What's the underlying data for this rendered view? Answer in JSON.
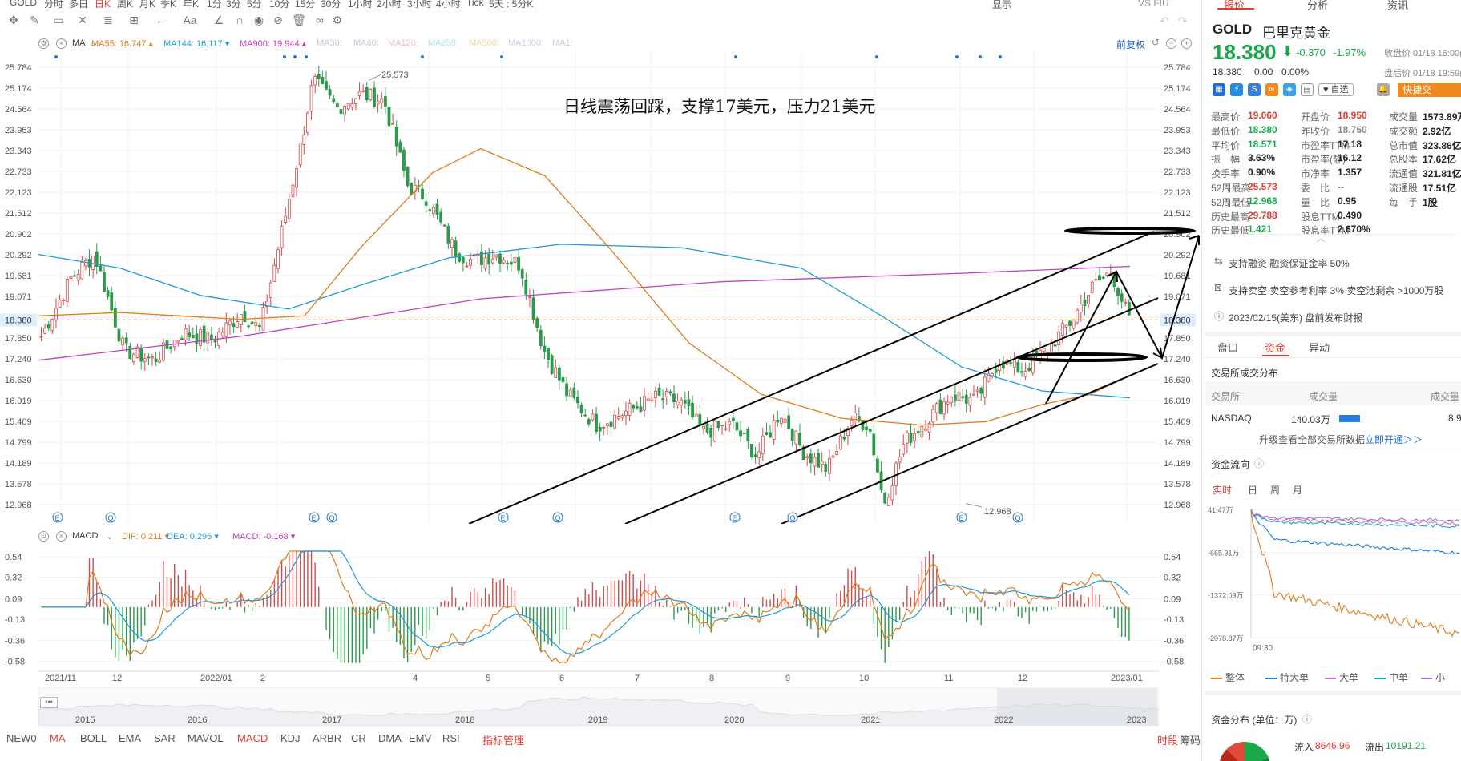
{
  "periods": [
    "GOLD",
    "分时",
    "多日",
    "日K",
    "周K",
    "月K",
    "季K",
    "年K",
    "1分",
    "3分",
    "5分",
    "10分",
    "15分",
    "30分",
    "1小时",
    "2小时",
    "3小时",
    "4小时",
    "Tick",
    "5天 : 5分K"
  ],
  "periods_active": 3,
  "toolbar_right": {
    "display": "显示",
    "vs": "VS FIU"
  },
  "ma_bar": {
    "label": "MA",
    "items": [
      {
        "text": "MA55: 16.747 ▴",
        "color": "#e07b1a"
      },
      {
        "text": "MA144: 16.117 ▾",
        "color": "#1e9bd7"
      },
      {
        "text": "MA900: 19.944 ▴",
        "color": "#c040c0"
      },
      {
        "text": "MA30:",
        "color": "#c8c8d8"
      },
      {
        "text": "MA60:",
        "color": "#c8c8d8"
      },
      {
        "text": "MA120:",
        "color": "#f0c0c0"
      },
      {
        "text": "MA250:",
        "color": "#b0e0f0"
      },
      {
        "text": "MA500:",
        "color": "#f0d8a0"
      },
      {
        "text": "MA1000:",
        "color": "#d0c8e8"
      },
      {
        "text": "MA1:",
        "color": "#d0c8e8"
      }
    ],
    "adjust": "前复权"
  },
  "macd_bar": {
    "label": "MACD",
    "items": [
      {
        "text": "DIF: 0.211 ▾",
        "color": "#e07b1a"
      },
      {
        "text": "DEA: 0.296 ▾",
        "color": "#1e9bd7"
      },
      {
        "text": "MACD: -0.168 ▾",
        "color": "#c040c0"
      }
    ]
  },
  "annotation_text": "日线震荡回踩，支撑17美元，压力21美元",
  "high_label": "25.573",
  "low_label": "12.968",
  "current_price_tag": "18.380",
  "price_axis": [
    "25.784",
    "25.174",
    "24.564",
    "23.953",
    "23.343",
    "22.733",
    "22.123",
    "21.512",
    "20.902",
    "20.292",
    "19.681",
    "19.071",
    "18.461",
    "17.850",
    "17.240",
    "16.630",
    "16.019",
    "15.409",
    "14.799",
    "14.189",
    "13.578",
    "12.968"
  ],
  "macd_axis": [
    "0.54",
    "0.32",
    "0.09",
    "-0.13",
    "-0.36",
    "-0.58"
  ],
  "month_axis": [
    "2021/11",
    "12",
    "2022/01",
    "2",
    "4",
    "5",
    "6",
    "7",
    "8",
    "9",
    "10",
    "11",
    "12",
    "2023/01"
  ],
  "overview_years": [
    "2015",
    "2016",
    "2017",
    "2018",
    "2019",
    "2020",
    "2021",
    "2022",
    "2023"
  ],
  "bottom_tabs": [
    "NEW0",
    "MA",
    "BOLL",
    "EMA",
    "SAR",
    "MAVOL",
    "MACD",
    "KDJ",
    "ARBR",
    "CR",
    "DMA",
    "EMV",
    "RSI",
    "指标管理"
  ],
  "bottom_right": [
    "时段",
    "筹码"
  ],
  "right": {
    "top_tabs": [
      "报价",
      "分析",
      "资讯"
    ],
    "symbol": "GOLD",
    "name": "巴里克黄金",
    "price": "18.380",
    "arrow": "⬇",
    "change": "-0.370",
    "change_pct": "-1.97%",
    "close_time": "收盘价 01/18 16:00(",
    "after_price": "18.380",
    "after_change": "0.00",
    "after_pct": "0.00%",
    "after_time": "盘后价 01/18 19:59(",
    "watch_label": "自选",
    "quick_label": "快捷交",
    "stats": [
      [
        [
          "最高价",
          "19.060",
          "red"
        ],
        [
          "开盘价",
          "18.950",
          "red"
        ],
        [
          "成交量",
          "1573.89万",
          ""
        ]
      ],
      [
        [
          "最低价",
          "18.380",
          "green"
        ],
        [
          "昨收价",
          "18.750",
          "gray"
        ],
        [
          "成交额",
          "2.92亿",
          ""
        ]
      ],
      [
        [
          "平均价",
          "18.571",
          "green"
        ],
        [
          "市盈率TTM",
          "17.18",
          ""
        ],
        [
          "总市值",
          "323.86亿",
          ""
        ]
      ],
      [
        [
          "振　幅",
          "3.63%",
          ""
        ],
        [
          "市盈率(静)",
          "16.12",
          ""
        ],
        [
          "总股本",
          "17.62亿",
          ""
        ]
      ],
      [
        [
          "换手率",
          "0.90%",
          ""
        ],
        [
          "市净率",
          "1.357",
          ""
        ],
        [
          "流通值",
          "321.81亿",
          ""
        ]
      ],
      [
        [
          "52周最高",
          "25.573",
          "red"
        ],
        [
          "委　比",
          "--",
          ""
        ],
        [
          "流通股",
          "17.51亿",
          ""
        ]
      ],
      [
        [
          "52周最低",
          "12.968",
          "green"
        ],
        [
          "量　比",
          "0.95",
          ""
        ],
        [
          "每　手",
          "1股",
          ""
        ]
      ],
      [
        [
          "历史最高",
          "29.788",
          "red"
        ],
        [
          "股息TTM",
          "0.490",
          ""
        ],
        [
          "",
          "",
          ""
        ]
      ],
      [
        [
          "历史最低",
          "1.421",
          "green"
        ],
        [
          "股息率TTM",
          "2.670%",
          ""
        ],
        [
          "",
          "",
          ""
        ]
      ]
    ],
    "notices": [
      "支持融资  融资保证金率 50%",
      "支持卖空  卖空参考利率 3%  卖空池剩余 >1000万股",
      "2023/02/15(美东)  盘前发布财报"
    ],
    "sub_tabs": [
      "盘口",
      "资金",
      "异动"
    ],
    "exchange_title": "交易所成交分布",
    "exchange_headers": [
      "交易所",
      "成交量",
      "成交量"
    ],
    "exchange_row": [
      "NASDAQ",
      "140.03万",
      "8.9"
    ],
    "upgrade_text": "升级查看全部交易所数据",
    "upgrade_link": "立即开通＞＞",
    "flow_title": "资金流向",
    "flow_tabs": [
      "实时",
      "日",
      "周",
      "月"
    ],
    "flow_axis": [
      "41.47万",
      "-665.31万",
      "-1372.09万",
      "-2078.87万"
    ],
    "flow_time": "09:30",
    "flow_legend": [
      {
        "name": "整体",
        "color": "#e07b1a"
      },
      {
        "name": "特大单",
        "color": "#1e7bd7"
      },
      {
        "name": "大单",
        "color": "#d070d0"
      },
      {
        "name": "中单",
        "color": "#18a8b8"
      },
      {
        "name": "小",
        "color": "#a070d0"
      }
    ],
    "dist_title": "资金分布 (单位：万)",
    "inflow_label": "流入",
    "inflow_value": "8646.96",
    "outflow_label": "流出",
    "outflow_value": "10191.21"
  }
}
